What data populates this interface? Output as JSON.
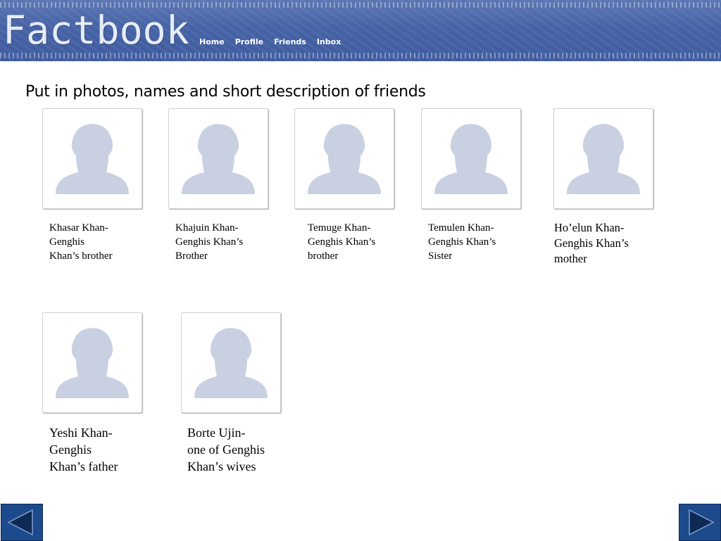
{
  "header": {
    "logo": "Factbook",
    "nav": [
      "Home",
      "Profile",
      "Friends",
      "Inbox"
    ]
  },
  "instruction": "Put in photos, names and short description of friends",
  "friends": [
    {
      "caption": "Khasar Khan-\nGenghis\nKhan’s brother"
    },
    {
      "caption": "Khajuin Khan-\nGenghis Khan’s\nBrother"
    },
    {
      "caption": "Temuge Khan-\nGenghis Khan’s\nbrother"
    },
    {
      "caption": "Temulen Khan-\nGenghis Khan’s\nSister"
    },
    {
      "caption": "Ho’elun Khan-\nGenghis Khan’s\nmother"
    },
    {
      "caption": "Yeshi Khan-\nGenghis\nKhan’s father"
    },
    {
      "caption": "Borte Ujin-\none of Genghis\nKhan’s wives"
    }
  ],
  "icons": {
    "avatar": "default-profile-silhouette-icon",
    "prev": "previous-slide-triangle-icon",
    "next": "next-slide-triangle-icon"
  },
  "colors": {
    "banner": "#4663a6",
    "silhouette": "#c9d0e2",
    "nav_button": "#1c4a8c"
  }
}
